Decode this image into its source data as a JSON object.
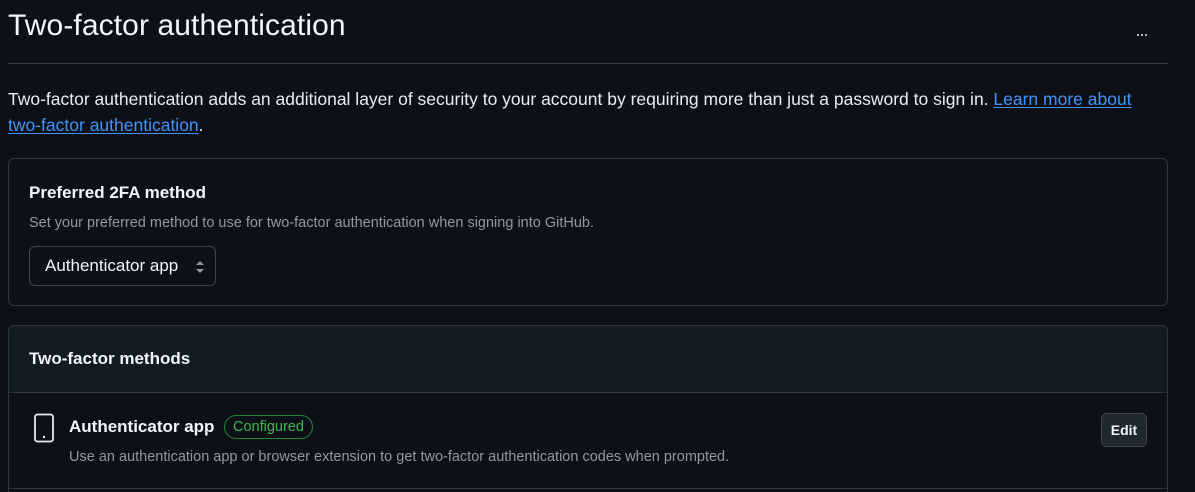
{
  "header": {
    "title": "Two-factor authentication",
    "more_button_label": "..."
  },
  "intro": {
    "text": "Two-factor authentication adds an additional layer of security to your account by requiring more than just a password to sign in. ",
    "link_text": "Learn more about two-factor authentication",
    "trailing": "."
  },
  "preferred": {
    "title": "Preferred 2FA method",
    "description": "Set your preferred method to use for two-factor authentication when signing into GitHub.",
    "selected_value": "Authenticator app",
    "chevron_icon": "chevron-up-down-icon"
  },
  "methods": {
    "title": "Two-factor methods",
    "items": [
      {
        "name": "Authenticator app",
        "icon": "device-mobile-icon",
        "status_badge": "Configured",
        "description": "Use an authentication app or browser extension to get two-factor authentication codes when prompted.",
        "action_label": "Edit"
      }
    ]
  },
  "colors": {
    "background": "#0d1117",
    "link": "#4493f8",
    "success": "#3fb950",
    "border": "#30363d",
    "muted_text": "#9198a1"
  }
}
